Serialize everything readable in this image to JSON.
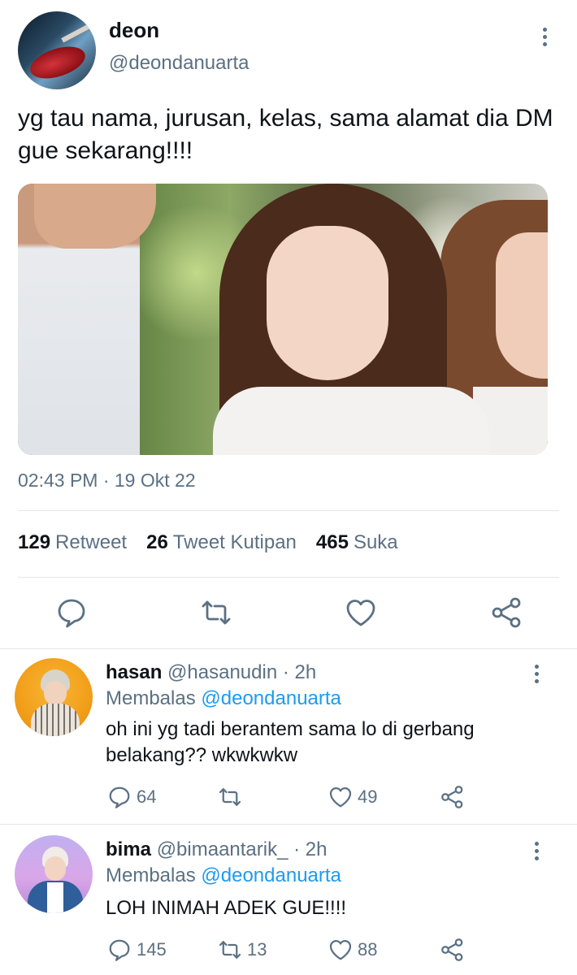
{
  "tweet": {
    "author_name": "deon",
    "author_handle": "@deondanuarta",
    "text": "yg tau nama, jurusan, kelas, sama alamat dia DM gue sekarang!!!!",
    "timestamp": "02:43 PM · 19 Okt 22",
    "stats": {
      "retweets": "129",
      "retweets_label": "Retweet",
      "quotes": "26",
      "quotes_label": "Tweet Kutipan",
      "likes": "465",
      "likes_label": "Suka"
    },
    "actions": [
      "reply-icon",
      "retweet-icon",
      "like-icon",
      "share-icon"
    ]
  },
  "replies": [
    {
      "name": "hasan",
      "handle": "@hasanudin",
      "time": "· 2h",
      "replying_prefix": "Membalas",
      "replying_to": "@deondanuarta",
      "text": "oh ini yg tadi berantem sama lo di gerbang belakang?? wkwkwkw",
      "reply_count": "64",
      "retweet_count": "",
      "like_count": "49"
    },
    {
      "name": "bima",
      "handle": "@bimaantarik_",
      "time": "· 2h",
      "replying_prefix": "Membalas",
      "replying_to": "@deondanuarta",
      "text": "LOH INIMAH ADEK GUE!!!!",
      "reply_count": "145",
      "retweet_count": "13",
      "like_count": "88"
    }
  ],
  "colors": {
    "accent": "#1d9bf0",
    "muted": "#5b7083",
    "text": "#0f1419",
    "divider": "#e2e8ec"
  }
}
